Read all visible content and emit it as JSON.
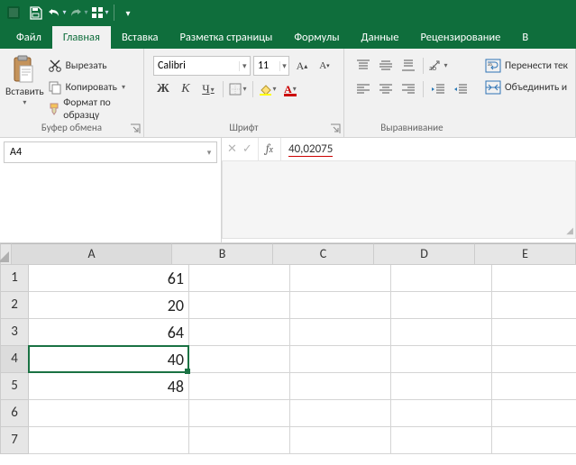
{
  "qat": {
    "save": "save-icon",
    "undo": "undo-icon",
    "redo": "redo-icon",
    "cust": "qat-customize"
  },
  "tabs": {
    "file": "Файл",
    "home": "Главная",
    "insert": "Вставка",
    "layout": "Разметка страницы",
    "formulas": "Формулы",
    "data": "Данные",
    "review": "Рецензирование",
    "view": "В"
  },
  "ribbon": {
    "clipboard": {
      "paste": "Вставить",
      "cut": "Вырезать",
      "copy": "Копировать",
      "format": "Формат по образцу",
      "group": "Буфер обмена"
    },
    "font": {
      "name": "Calibri",
      "size": "11",
      "group": "Шрифт",
      "bold": "Ж",
      "italic": "К",
      "under": "Ч"
    },
    "align": {
      "group": "Выравнивание",
      "wrap": "Перенести тек",
      "merge": "Объединить и"
    }
  },
  "namebox": "A4",
  "formula": "40,02075",
  "cols": [
    "A",
    "B",
    "C",
    "D",
    "E"
  ],
  "rows": [
    "1",
    "2",
    "3",
    "4",
    "5",
    "6",
    "7"
  ],
  "cells": {
    "A1": "61",
    "A2": "20",
    "A3": "64",
    "A4": "40",
    "A5": "48"
  },
  "selected": {
    "row": 4,
    "col": "A"
  },
  "chart_data": {
    "type": "table",
    "columns": [
      "A"
    ],
    "values": [
      61,
      20,
      64,
      40,
      48
    ]
  }
}
